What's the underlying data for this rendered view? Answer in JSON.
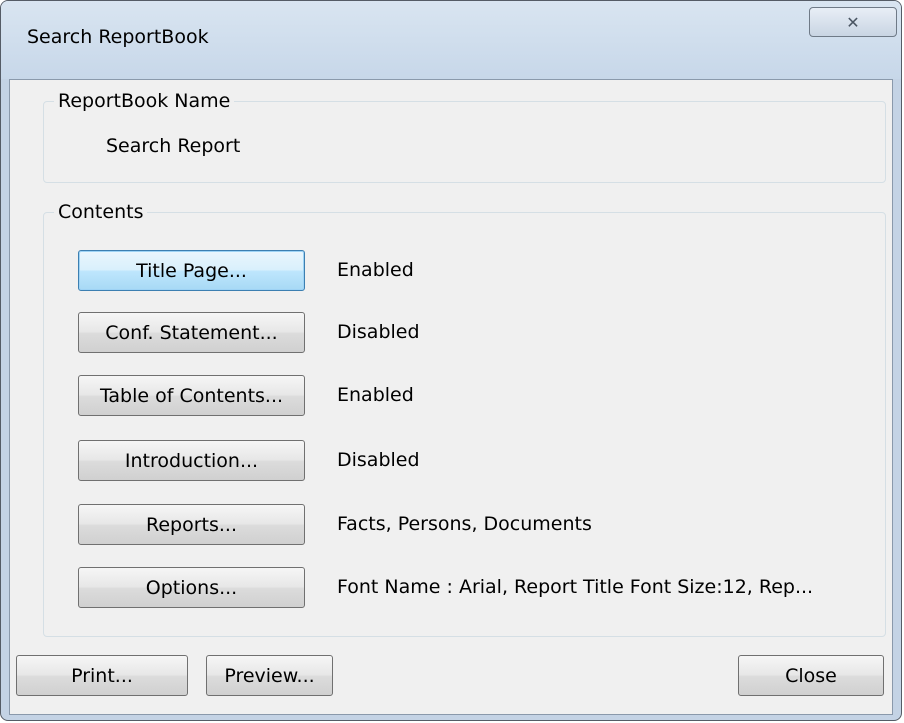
{
  "window": {
    "title": "Search ReportBook",
    "close_glyph": "✕"
  },
  "reportbook_group": {
    "title": "ReportBook Name",
    "name_value": "Search Report"
  },
  "contents_group": {
    "title": "Contents",
    "rows": [
      {
        "button_label": "Title Page...",
        "status": "Enabled"
      },
      {
        "button_label": "Conf. Statement...",
        "status": "Disabled"
      },
      {
        "button_label": "Table of Contents...",
        "status": "Enabled"
      },
      {
        "button_label": "Introduction...",
        "status": "Disabled"
      },
      {
        "button_label": "Reports...",
        "status": "Facts, Persons, Documents"
      },
      {
        "button_label": "Options...",
        "status": "Font Name : Arial, Report Title Font Size:12, Rep..."
      }
    ]
  },
  "footer": {
    "print_label": "Print...",
    "preview_label": "Preview...",
    "close_label": "Close"
  }
}
